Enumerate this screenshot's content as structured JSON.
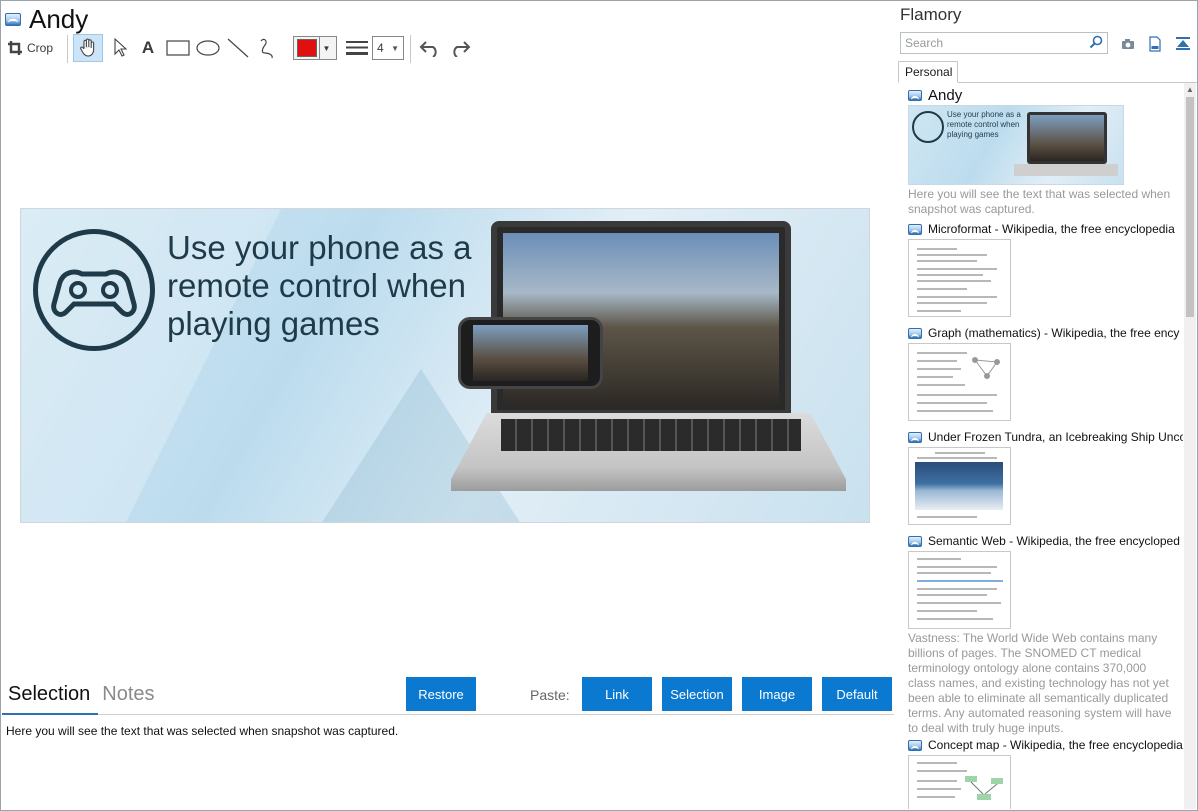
{
  "window": {
    "title": "Andy"
  },
  "toolbar": {
    "crop_label": "Crop",
    "color_hex": "#e01010",
    "line_width": "4",
    "tools": [
      "hand-icon",
      "pointer-icon",
      "text-icon",
      "rectangle-icon",
      "ellipse-icon",
      "line-icon",
      "freehand-icon",
      "line-width-icon",
      "undo-icon",
      "redo-icon"
    ]
  },
  "canvas": {
    "ad_text": "Use your phone as a remote control when playing games"
  },
  "bottom": {
    "tabs": [
      "Selection",
      "Notes"
    ],
    "active_tab": "Selection",
    "restore_label": "Restore",
    "paste_label": "Paste:",
    "paste_buttons": [
      "Link",
      "Selection",
      "Image",
      "Default"
    ],
    "selection_text": "Here you will see the text that was selected when snapshot was captured."
  },
  "sidebar": {
    "title": "Flamory",
    "search_placeholder": "Search",
    "tab": "Personal",
    "items": [
      {
        "title": "Andy",
        "thumb_text": "Use your phone as a remote control when playing games",
        "desc": "Here you will see the text that was selected when snapshot was captured."
      },
      {
        "title": "Microformat - Wikipedia, the free encyclopedia"
      },
      {
        "title": "Graph (mathematics) - Wikipedia, the free ency"
      },
      {
        "title": "Under Frozen Tundra, an Icebreaking Ship Unco"
      },
      {
        "title": "Semantic Web - Wikipedia, the free encycloped",
        "desc": "Vastness: The World Wide Web contains many billions of pages. The SNOMED CT medical terminology ontology alone contains 370,000 class names, and existing technology has not yet been able to eliminate all semantically duplicated terms. Any automated reasoning system will have to deal with truly huge inputs."
      },
      {
        "title": "Concept map - Wikipedia, the free encyclopedia"
      }
    ]
  }
}
